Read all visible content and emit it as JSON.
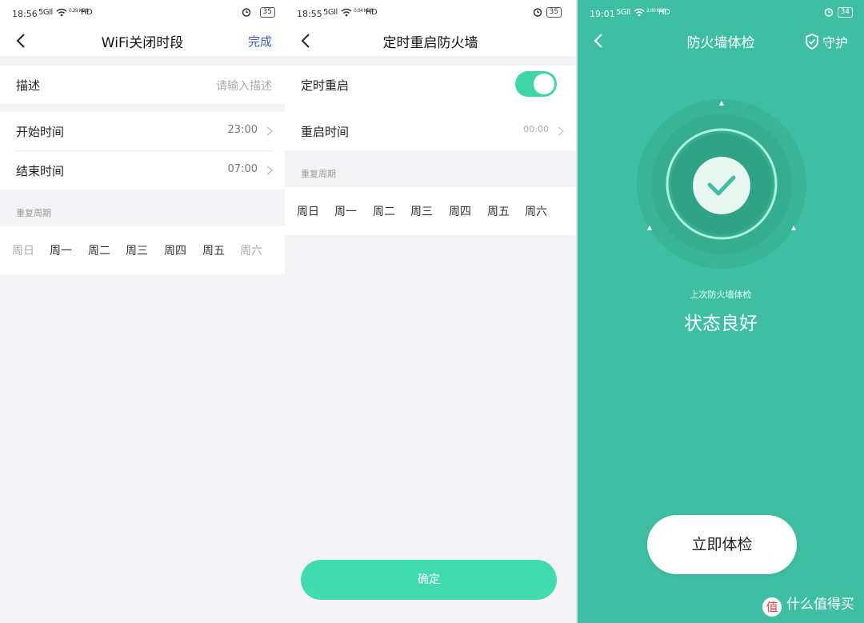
{
  "panel1": {
    "status": {
      "time": "18:56",
      "signal": "5GIl",
      "speed": "0.29 KB/S",
      "net": "HD",
      "battery": "35"
    },
    "title": "WiFi关闭时段",
    "done_label": "完成",
    "description": {
      "label": "描述",
      "placeholder": "请输入描述"
    },
    "start_time": {
      "label": "开始时间",
      "value": "23:00"
    },
    "end_time": {
      "label": "结束时间",
      "value": "07:00"
    },
    "repeat_label": "重复周期",
    "days": [
      {
        "label": "周日",
        "selected": false
      },
      {
        "label": "周一",
        "selected": true
      },
      {
        "label": "周二",
        "selected": true
      },
      {
        "label": "周三",
        "selected": true
      },
      {
        "label": "周四",
        "selected": true
      },
      {
        "label": "周五",
        "selected": true
      },
      {
        "label": "周六",
        "selected": false
      }
    ]
  },
  "panel2": {
    "status": {
      "time": "18:55",
      "signal": "5GIl",
      "speed": "0.04 KB/S",
      "net": "HD",
      "battery": "35"
    },
    "title": "定时重启防火墙",
    "timed_restart": {
      "label": "定时重启",
      "enabled": true
    },
    "restart_time": {
      "label": "重启时间",
      "value": "00:00"
    },
    "repeat_label": "重复周期",
    "days": [
      "周日",
      "周一",
      "周二",
      "周三",
      "周四",
      "周五",
      "周六"
    ],
    "confirm_label": "确定"
  },
  "panel3": {
    "status": {
      "time": "19:01",
      "signal": "5GIl",
      "speed": "2.00 KB/S",
      "net": "HD",
      "battery": "34"
    },
    "title": "防火墙体检",
    "guard_label": "守护",
    "last_check_label": "上次防火墙体检",
    "state_label": "状态良好",
    "check_now_label": "立即体检",
    "watermark": "什么值得买",
    "watermark_icon": "值",
    "accent": "#3ebfa3"
  }
}
